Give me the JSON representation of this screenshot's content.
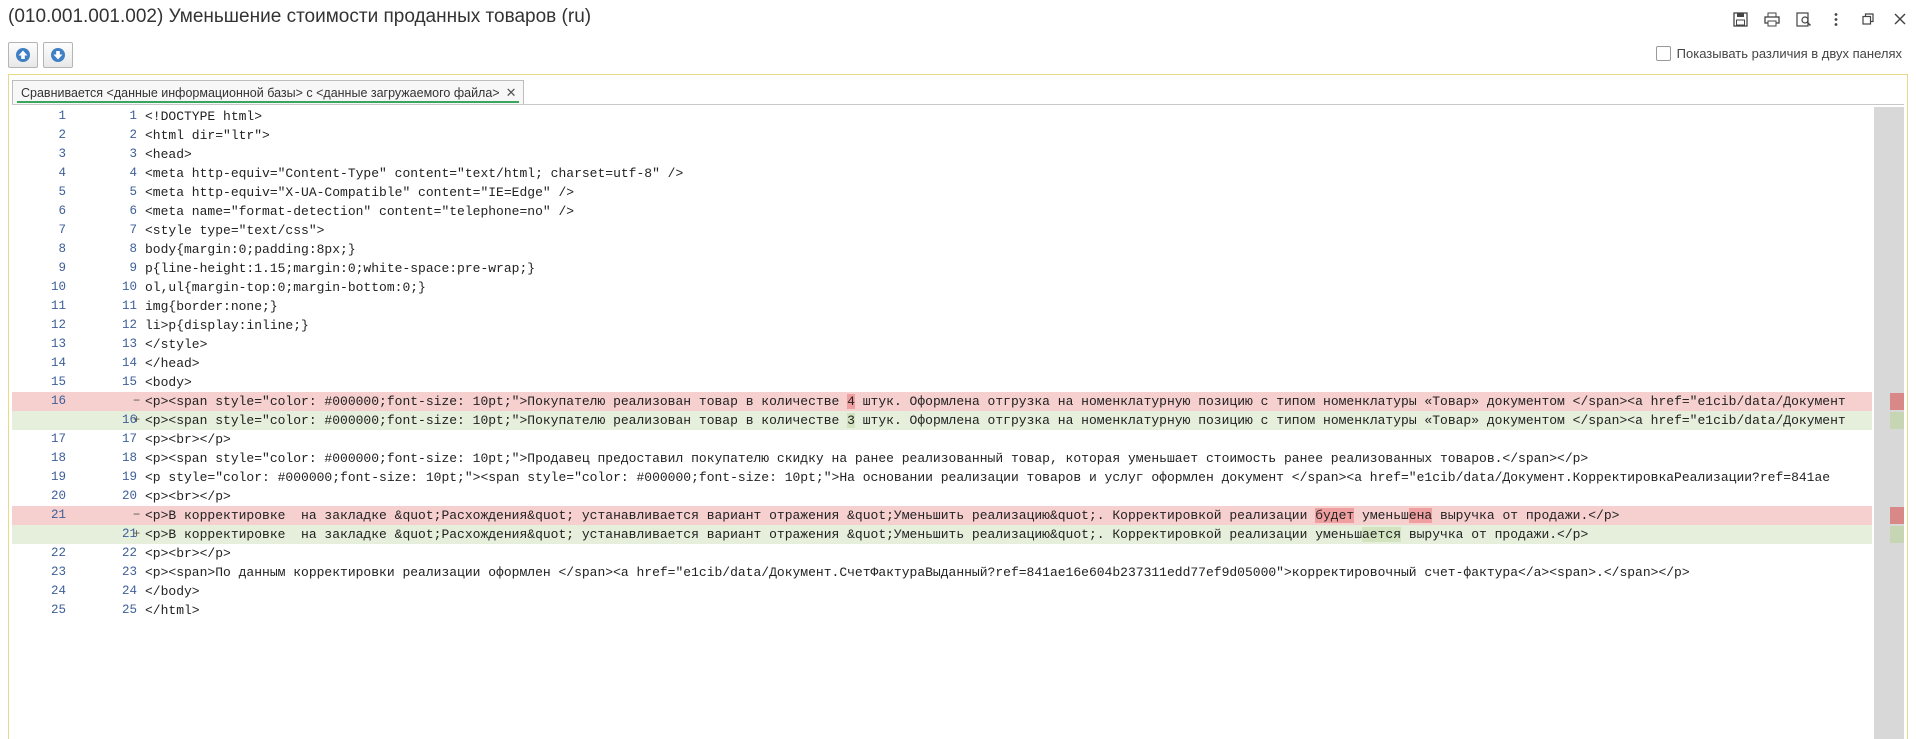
{
  "window": {
    "title": "(010.001.001.002) Уменьшение стоимости проданных товаров  (ru)",
    "icons": [
      "save-icon",
      "print-icon",
      "print-preview-icon",
      "more-icon",
      "restore-icon",
      "close-icon"
    ]
  },
  "toolbar": {
    "show_two_panels_label": "Показывать различия в двух панелях"
  },
  "tab": {
    "label": "Сравнивается <данные информационной базы> с <данные загружаемого файла>"
  },
  "colors": {
    "removed": "#f6cfcf",
    "added": "#e6efdc",
    "tab_accent": "#3aa55c",
    "line_numbers": "#3d5f99"
  },
  "diff_lines": [
    {
      "ln1": "1",
      "ln2": "1",
      "mark": "",
      "type": "same",
      "text": "<!DOCTYPE html>"
    },
    {
      "ln1": "2",
      "ln2": "2",
      "mark": "",
      "type": "same",
      "text": "<html dir=\"ltr\">"
    },
    {
      "ln1": "3",
      "ln2": "3",
      "mark": "",
      "type": "same",
      "text": "<head>"
    },
    {
      "ln1": "4",
      "ln2": "4",
      "mark": "",
      "type": "same",
      "text": "<meta http-equiv=\"Content-Type\" content=\"text/html; charset=utf-8\" />"
    },
    {
      "ln1": "5",
      "ln2": "5",
      "mark": "",
      "type": "same",
      "text": "<meta http-equiv=\"X-UA-Compatible\" content=\"IE=Edge\" />"
    },
    {
      "ln1": "6",
      "ln2": "6",
      "mark": "",
      "type": "same",
      "text": "<meta name=\"format-detection\" content=\"telephone=no\" />"
    },
    {
      "ln1": "7",
      "ln2": "7",
      "mark": "",
      "type": "same",
      "text": "<style type=\"text/css\">"
    },
    {
      "ln1": "8",
      "ln2": "8",
      "mark": "",
      "type": "same",
      "text": "body{margin:0;padding:8px;}"
    },
    {
      "ln1": "9",
      "ln2": "9",
      "mark": "",
      "type": "same",
      "text": "p{line-height:1.15;margin:0;white-space:pre-wrap;}"
    },
    {
      "ln1": "10",
      "ln2": "10",
      "mark": "",
      "type": "same",
      "text": "ol,ul{margin-top:0;margin-bottom:0;}"
    },
    {
      "ln1": "11",
      "ln2": "11",
      "mark": "",
      "type": "same",
      "text": "img{border:none;}"
    },
    {
      "ln1": "12",
      "ln2": "12",
      "mark": "",
      "type": "same",
      "text": "li>p{display:inline;}"
    },
    {
      "ln1": "13",
      "ln2": "13",
      "mark": "",
      "type": "same",
      "text": "</style>"
    },
    {
      "ln1": "14",
      "ln2": "14",
      "mark": "",
      "type": "same",
      "text": "</head>"
    },
    {
      "ln1": "15",
      "ln2": "15",
      "mark": "",
      "type": "same",
      "text": "<body>"
    },
    {
      "ln1": "16",
      "ln2": "",
      "mark": "−",
      "type": "removed",
      "pre": "<p><span style=\"color: #000000;font-size: 10pt;\">Покупателю реализован товар в количестве ",
      "hl": "4",
      "post": " штук. Оформлена отгрузка на номенклатурную позицию с типом номенклатуры «Товар» документом </span><a href=\"e1cib/data/Документ"
    },
    {
      "ln1": "",
      "ln2": "16",
      "mark": "+",
      "type": "added",
      "pre": "<p><span style=\"color: #000000;font-size: 10pt;\">Покупателю реализован товар в количестве ",
      "hl": "3",
      "post": " штук. Оформлена отгрузка на номенклатурную позицию с типом номенклатуры «Товар» документом </span><a href=\"e1cib/data/Документ"
    },
    {
      "ln1": "17",
      "ln2": "17",
      "mark": "",
      "type": "same",
      "text": "<p><br></p>"
    },
    {
      "ln1": "18",
      "ln2": "18",
      "mark": "",
      "type": "same",
      "text": "<p><span style=\"color: #000000;font-size: 10pt;\">Продавец предоставил покупателю скидку на ранее реализованный товар, которая уменьшает стоимость ранее реализованных товаров.</span></p>"
    },
    {
      "ln1": "19",
      "ln2": "19",
      "mark": "",
      "type": "same",
      "text": "<p style=\"color: #000000;font-size: 10pt;\"><span style=\"color: #000000;font-size: 10pt;\">На основании реализации товаров и услуг оформлен документ </span><a href=\"e1cib/data/Документ.КорректировкаРеализации?ref=841ae"
    },
    {
      "ln1": "20",
      "ln2": "20",
      "mark": "",
      "type": "same",
      "text": "<p><br></p>"
    },
    {
      "ln1": "21",
      "ln2": "",
      "mark": "−",
      "type": "removed",
      "pre": "<p>В корректировке  на закладке &quot;Расхождения&quot; устанавливается вариант отражения &quot;Уменьшить реализацию&quot;. Корректировкой реализации ",
      "hl": "будет",
      "mid": " уменьш",
      "hl2": "ена",
      "post": " выручка от продажи.</p>"
    },
    {
      "ln1": "",
      "ln2": "21",
      "mark": "+",
      "type": "added",
      "pre": "<p>В корректировке  на закладке &quot;Расхождения&quot; устанавливается вариант отражения &quot;Уменьшить реализацию&quot;. Корректировкой реализации уменьш",
      "hl": "ается",
      "post": " выручка от продажи.</p>"
    },
    {
      "ln1": "22",
      "ln2": "22",
      "mark": "",
      "type": "same",
      "text": "<p><br></p>"
    },
    {
      "ln1": "23",
      "ln2": "23",
      "mark": "",
      "type": "same",
      "text": "<p><span>По данным корректировки реализации оформлен </span><a href=\"e1cib/data/Документ.СчетФактураВыданный?ref=841ae16e604b237311edd77ef9d05000\">корректировочный счет-фактура</a><span>.</span></p>"
    },
    {
      "ln1": "24",
      "ln2": "24",
      "mark": "",
      "type": "same",
      "text": "</body>"
    },
    {
      "ln1": "25",
      "ln2": "25",
      "mark": "",
      "type": "same",
      "text": "</html>"
    }
  ]
}
